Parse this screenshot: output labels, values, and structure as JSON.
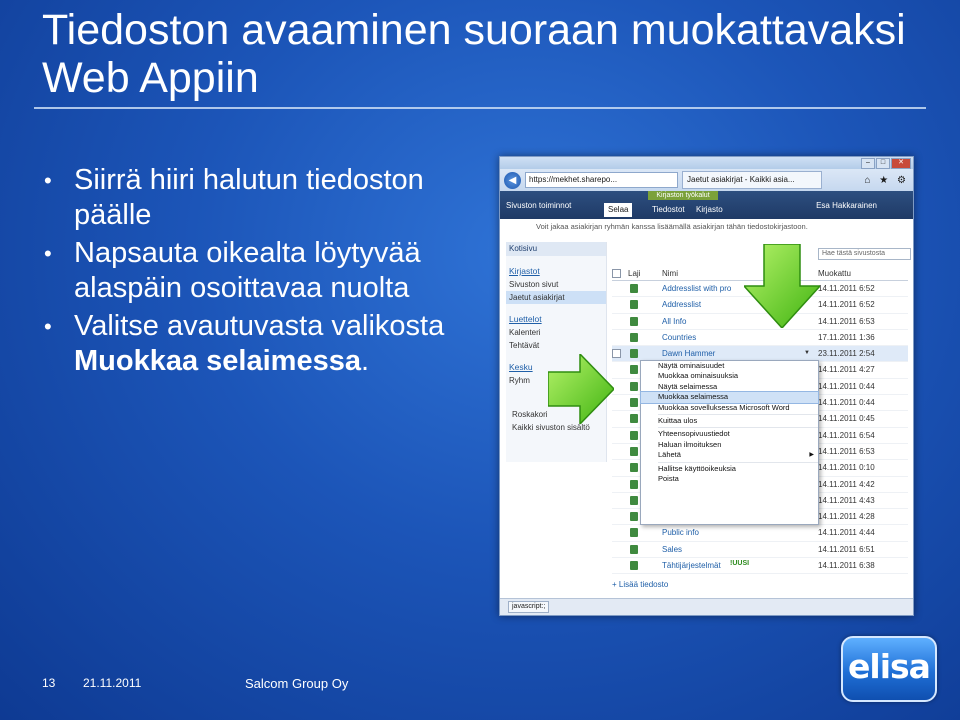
{
  "slide": {
    "title": "Tiedoston avaaminen suoraan muokattavaksi Web Appiin",
    "bullets": [
      {
        "text": "Siirrä hiiri halutun tiedoston päälle"
      },
      {
        "text": "Napsauta oikealta löytyvää alaspäin osoittavaa nuolta"
      },
      {
        "text_pre": "Valitse avautuvasta valikosta ",
        "text_bold": "Muokkaa selaimessa",
        "text_post": "."
      }
    ]
  },
  "browser": {
    "address": "https://mekhet.sharepo...",
    "tab_title": "Jaetut asiakirjat - Kaikki asia...",
    "nav_icons": "⌂ ★ ⚙"
  },
  "ribbon": {
    "site_actions": "Sivuston toiminnot",
    "context_group": "Kirjaston työkalut",
    "tab_browse": "Selaa",
    "tab_files": "Tiedostot",
    "tab_library": "Kirjasto",
    "user": "Esa Hakkarainen"
  },
  "notice": "Voit jakaa asiakirjan ryhmän kanssa lisäämällä asiakirjan tähän tiedostokirjastoon.",
  "leftnav": {
    "home": "Kotisivu",
    "libraries_header": "Kirjastot",
    "items": [
      "Sivuston sivut",
      "Jaetut asiakirjat"
    ],
    "lists_header": "Luettelot",
    "list_items": [
      "Kalenteri",
      "Tehtävät"
    ],
    "discussions_header": "Kesku",
    "discussion_item": "Ryhm",
    "recycle": "Roskakori",
    "all_content": "Kaikki sivuston sisältö"
  },
  "search_placeholder": "Hae tästä sivustosta",
  "list": {
    "col_type": "Laji",
    "col_name": "Nimi",
    "col_modified": "Muokattu",
    "rows": [
      {
        "name": "Addresslist with pro",
        "date": "14.11.2011 6:52"
      },
      {
        "name": "Addresslist",
        "date": "14.11.2011 6:52"
      },
      {
        "name": "All Info",
        "date": "14.11.2011 6:53"
      },
      {
        "name": "Countries",
        "date": "17.11.2011 1:36"
      },
      {
        "name": "Dawn Hammer",
        "date": "23.11.2011 2:54"
      },
      {
        "name": "",
        "date": "14.11.2011 4:27"
      },
      {
        "name": "",
        "date": "14.11.2011 0:44"
      },
      {
        "name": "",
        "date": "14.11.2011 0:44"
      },
      {
        "name": "",
        "date": "14.11.2011 0:45"
      },
      {
        "name": "",
        "date": "14.11.2011 6:54"
      },
      {
        "name": "",
        "date": "14.11.2011 6:53"
      },
      {
        "name": "",
        "date": "14.11.2011 0:10"
      },
      {
        "name": "",
        "date": "14.11.2011 4:42"
      },
      {
        "name": "",
        "date": "14.11.2011 4:43"
      },
      {
        "name": "",
        "date": "14.11.2011 4:28"
      },
      {
        "name": "Public info",
        "date": "14.11.2011 4:44"
      },
      {
        "name": "Sales",
        "date": "14.11.2011 6:51"
      },
      {
        "name": "Tähtijärjestelmät",
        "date": "14.11.2011 6:38"
      }
    ],
    "new_badge": "!UUSI",
    "add_link": "Lisää tiedosto"
  },
  "context_menu": [
    {
      "label": "Näytä ominaisuudet"
    },
    {
      "label": "Muokkaa ominaisuuksia"
    },
    {
      "label": "Näytä selaimessa"
    },
    {
      "label": "Muokkaa selaimessa",
      "active": true
    },
    {
      "label": "Muokkaa sovelluksessa Microsoft Word"
    },
    {
      "label": "Kuittaa ulos"
    },
    {
      "label": "Yhteensopivuustiedot"
    },
    {
      "label": "Haluan ilmoituksen"
    },
    {
      "label": "Lähetä",
      "submenu": true
    },
    {
      "label": "Hallitse käyttöoikeuksia"
    },
    {
      "label": "Poista"
    }
  ],
  "statusbar": "javascript:;",
  "footer": {
    "page_number": "13",
    "date": "21.11.2011",
    "company": "Salcom Group Oy"
  },
  "logo_text": "elisa",
  "colors": {
    "background": "#1c55b8",
    "arrow_green": "#7ddc2a",
    "link_blue": "#1f5fa8"
  }
}
